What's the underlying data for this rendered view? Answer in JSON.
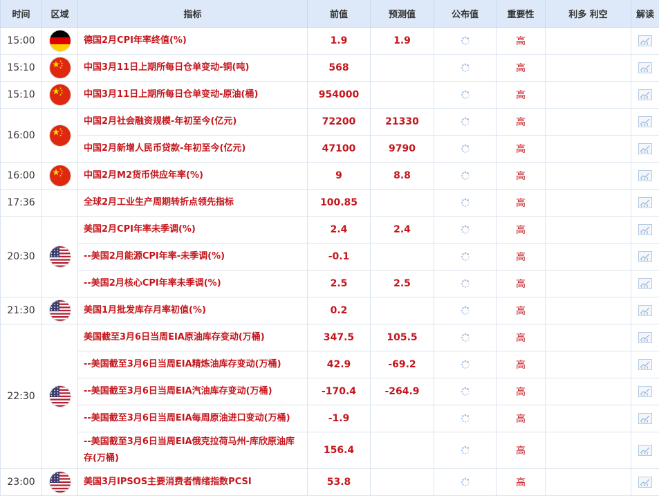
{
  "header": {
    "time": "时间",
    "region": "区域",
    "indicator": "指标",
    "previous": "前值",
    "forecast": "预测值",
    "actual": "公布值",
    "importance": "重要性",
    "impact": "利多 利空",
    "analysis": "解读"
  },
  "rows": [
    {
      "time": "15:00",
      "flag": "germany-flag-icon",
      "items": [
        {
          "indicator": "德国2月CPI年率终值(%)",
          "previous": "1.9",
          "forecast": "1.9",
          "importance": "高"
        }
      ]
    },
    {
      "time": "15:10",
      "flag": "china-flag-icon",
      "items": [
        {
          "indicator": "中国3月11日上期所每日仓单变动-铜(吨)",
          "previous": "568",
          "forecast": "",
          "importance": "高"
        }
      ]
    },
    {
      "time": "15:10",
      "flag": "china-flag-icon",
      "items": [
        {
          "indicator": "中国3月11日上期所每日仓单变动-原油(桶)",
          "previous": "954000",
          "forecast": "",
          "importance": "高"
        }
      ]
    },
    {
      "time": "16:00",
      "flag": "china-flag-icon",
      "items": [
        {
          "indicator": "中国2月社会融资规模-年初至今(亿元)",
          "previous": "72200",
          "forecast": "21330",
          "importance": "高"
        },
        {
          "indicator": "中国2月新增人民币贷款-年初至今(亿元)",
          "previous": "47100",
          "forecast": "9790",
          "importance": "高"
        }
      ]
    },
    {
      "time": "16:00",
      "flag": "china-flag-icon",
      "items": [
        {
          "indicator": "中国2月M2货币供应年率(%)",
          "previous": "9",
          "forecast": "8.8",
          "importance": "高"
        }
      ]
    },
    {
      "time": "17:36",
      "flag": "",
      "items": [
        {
          "indicator": "全球2月工业生产周期转折点领先指标",
          "previous": "100.85",
          "forecast": "",
          "importance": "高"
        }
      ]
    },
    {
      "time": "20:30",
      "flag": "usa-flag-icon",
      "items": [
        {
          "indicator": "美国2月CPI年率未季调(%)",
          "previous": "2.4",
          "forecast": "2.4",
          "importance": "高"
        },
        {
          "indicator": "--美国2月能源CPI年率-未季调(%)",
          "previous": "-0.1",
          "forecast": "",
          "importance": "高"
        },
        {
          "indicator": "--美国2月核心CPI年率未季调(%)",
          "previous": "2.5",
          "forecast": "2.5",
          "importance": "高"
        }
      ]
    },
    {
      "time": "21:30",
      "flag": "usa-flag-icon",
      "items": [
        {
          "indicator": "美国1月批发库存月率初值(%)",
          "previous": "0.2",
          "forecast": "",
          "importance": "高"
        }
      ]
    },
    {
      "time": "22:30",
      "flag": "usa-flag-icon",
      "items": [
        {
          "indicator": "美国截至3月6日当周EIA原油库存变动(万桶)",
          "previous": "347.5",
          "forecast": "105.5",
          "importance": "高"
        },
        {
          "indicator": "--美国截至3月6日当周EIA精炼油库存变动(万桶)",
          "previous": "42.9",
          "forecast": "-69.2",
          "importance": "高"
        },
        {
          "indicator": "--美国截至3月6日当周EIA汽油库存变动(万桶)",
          "previous": "-170.4",
          "forecast": "-264.9",
          "importance": "高"
        },
        {
          "indicator": "--美国截至3月6日当周EIA每周原油进口变动(万桶)",
          "previous": "-1.9",
          "forecast": "",
          "importance": "高"
        },
        {
          "indicator": "--美国截至3月6日当周EIA俄克拉荷马州-库欣原油库存(万桶)",
          "previous": "156.4",
          "forecast": "",
          "importance": "高",
          "tall": true
        }
      ]
    },
    {
      "time": "23:00",
      "flag": "usa-flag-icon",
      "items": [
        {
          "indicator": "美国3月IPSOS主要消费者情绪指数PCSI",
          "previous": "53.8",
          "forecast": "",
          "importance": "高"
        }
      ]
    }
  ],
  "colors": {
    "header_bg": "#dde9f8",
    "indicator_red": "#c4161c",
    "border": "#dbe3ee"
  }
}
